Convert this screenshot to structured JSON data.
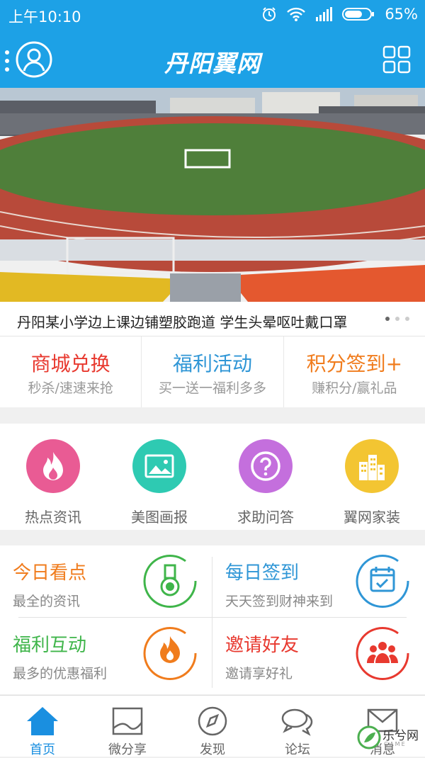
{
  "status_bar": {
    "time": "上午10:10",
    "battery": "65%"
  },
  "app_bar": {
    "title": "丹阳翼网"
  },
  "banner": {
    "caption": "丹阳某小学边上课边铺塑胶跑道 学生头晕呕吐戴口罩"
  },
  "promos": [
    {
      "title": "商城兑换",
      "subtitle": "秒杀/速速来抢",
      "color": "#e8392f"
    },
    {
      "title": "福利活动",
      "subtitle": "买一送一福利多多",
      "color": "#2f96d6"
    },
    {
      "title": "积分签到+",
      "subtitle": "赚积分/赢礼品",
      "color": "#f07c1d"
    }
  ],
  "categories": [
    {
      "label": "热点资讯",
      "icon": "fire-icon",
      "color": "#e95b94"
    },
    {
      "label": "美图画报",
      "icon": "picture-icon",
      "color": "#2ecab2"
    },
    {
      "label": "求助问答",
      "icon": "question-icon",
      "color": "#c46fdd"
    },
    {
      "label": "翼网家装",
      "icon": "buildings-icon",
      "color": "#f3c532"
    }
  ],
  "features": [
    {
      "title": "今日看点",
      "subtitle": "最全的资讯",
      "color": "#f07c1d",
      "ring": "#3fb54a",
      "icon": "medal-icon"
    },
    {
      "title": "每日签到",
      "subtitle": "天天签到财神来到",
      "color": "#2f96d6",
      "ring": "#2f96d6",
      "icon": "calendar-icon"
    },
    {
      "title": "福利互动",
      "subtitle": "最多的优惠福利",
      "color": "#3fb54a",
      "ring": "#f07c1d",
      "icon": "flame-icon"
    },
    {
      "title": "邀请好友",
      "subtitle": "邀请享好礼",
      "color": "#e8392f",
      "ring": "#e8392f",
      "icon": "people-icon"
    }
  ],
  "tabs": [
    {
      "label": "首页",
      "icon": "home-icon",
      "active": true
    },
    {
      "label": "微分享",
      "icon": "image-frame-icon",
      "active": false
    },
    {
      "label": "发现",
      "icon": "compass-icon",
      "active": false
    },
    {
      "label": "论坛",
      "icon": "chat-bubbles-icon",
      "active": false
    },
    {
      "label": "消息",
      "icon": "envelope-icon",
      "active": false
    }
  ],
  "watermark": {
    "text": "乐兮网",
    "subtext": "GAME"
  }
}
